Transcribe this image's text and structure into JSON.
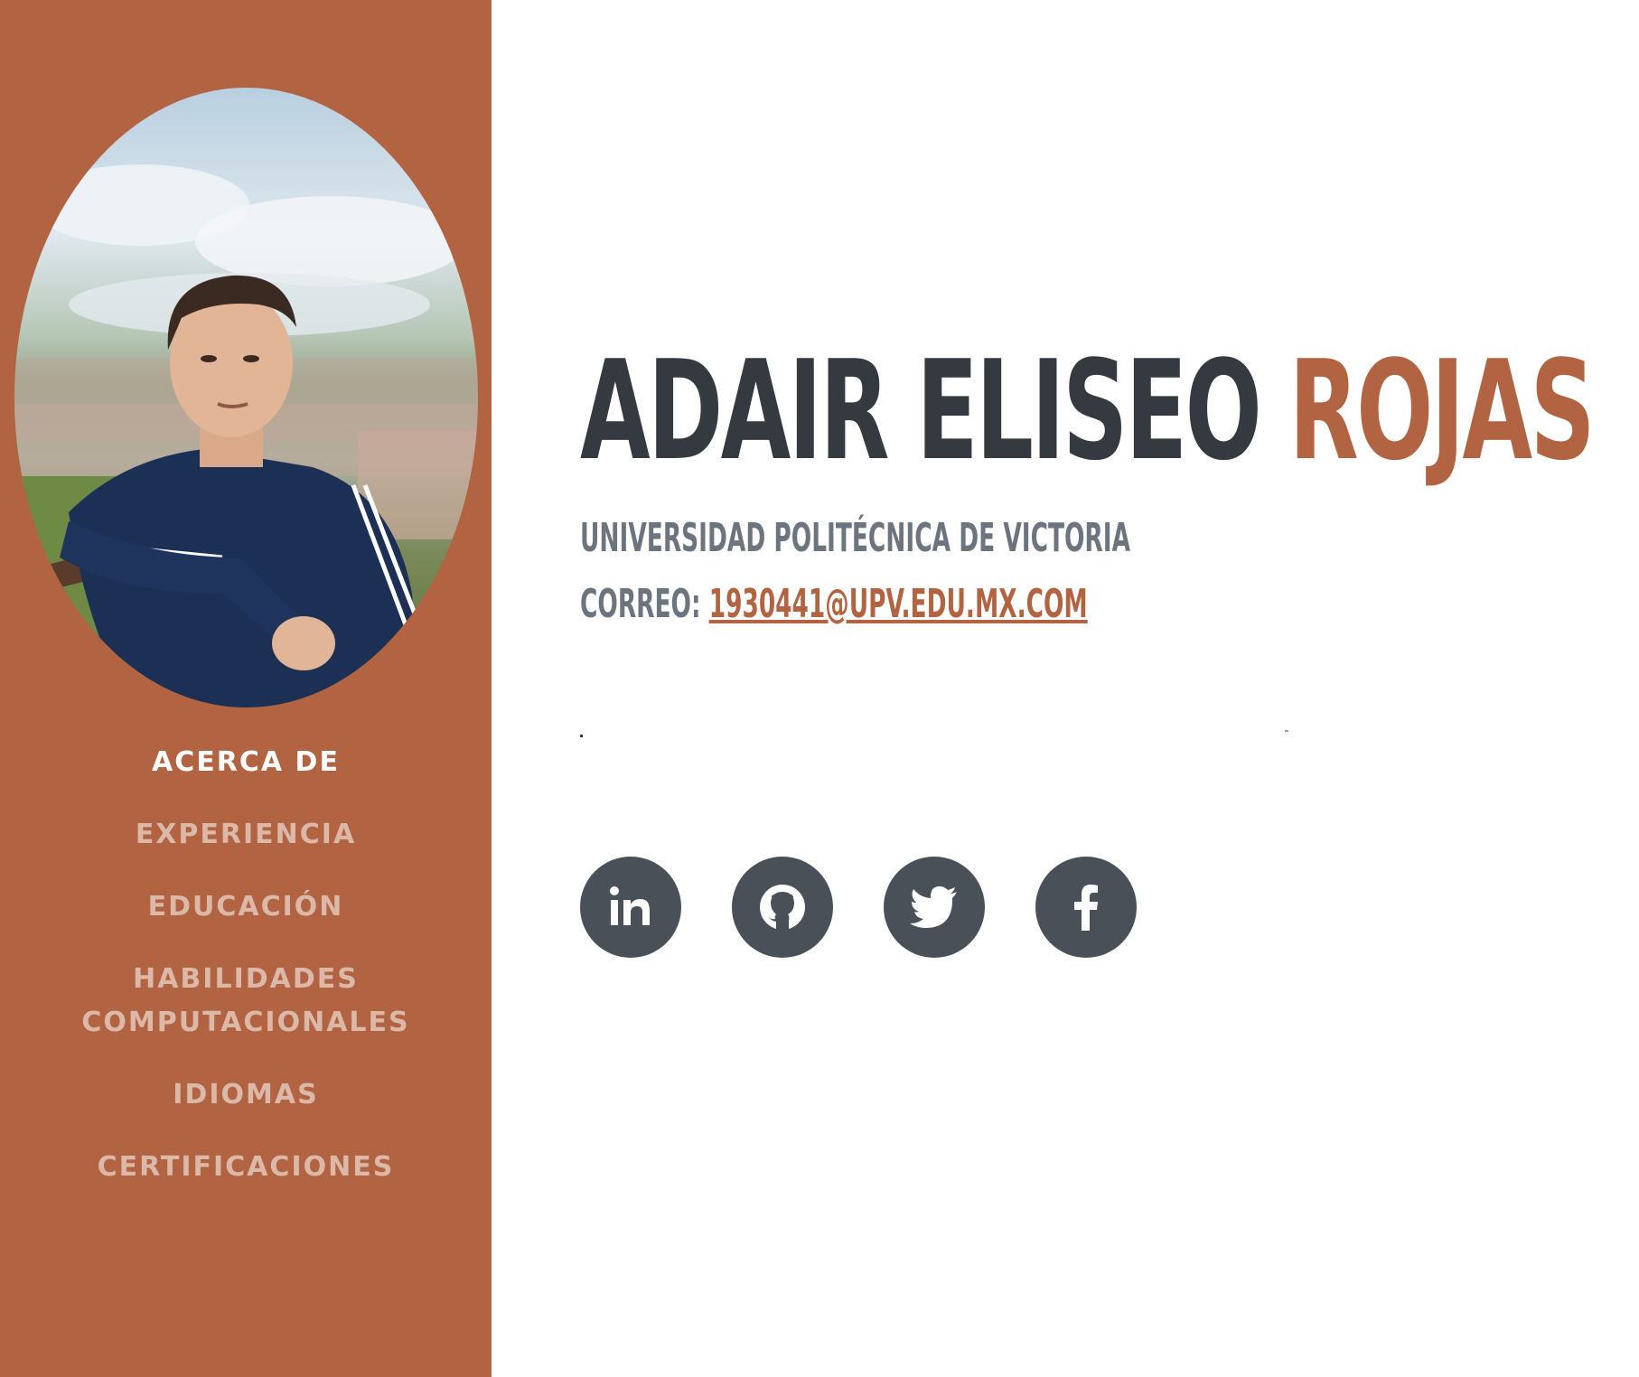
{
  "profile": {
    "first_names": "ADAIR ELISEO",
    "last_name": "ROJAS",
    "university": "UNIVERSIDAD POLITÉCNICA DE VICTORIA",
    "email_label": "CORREO:",
    "email": "1930441@UPV.EDU.MX.COM",
    "photo_alt": "profile photo"
  },
  "nav": {
    "items": [
      {
        "label": "ACERCA DE",
        "active": true
      },
      {
        "label": "EXPERIENCIA",
        "active": false
      },
      {
        "label": "EDUCACIÓN",
        "active": false
      },
      {
        "label": "HABILIDADES COMPUTACIONALES",
        "active": false
      },
      {
        "label": "IDIOMAS",
        "active": false
      },
      {
        "label": "CERTIFICACIONES",
        "active": false
      }
    ]
  },
  "social": {
    "icons": [
      "linkedin-icon",
      "github-icon",
      "twitter-icon",
      "facebook-icon"
    ]
  },
  "colors": {
    "primary": "#b26341",
    "heading": "#343a40",
    "muted": "#6c757d",
    "social_bg": "#495057"
  }
}
